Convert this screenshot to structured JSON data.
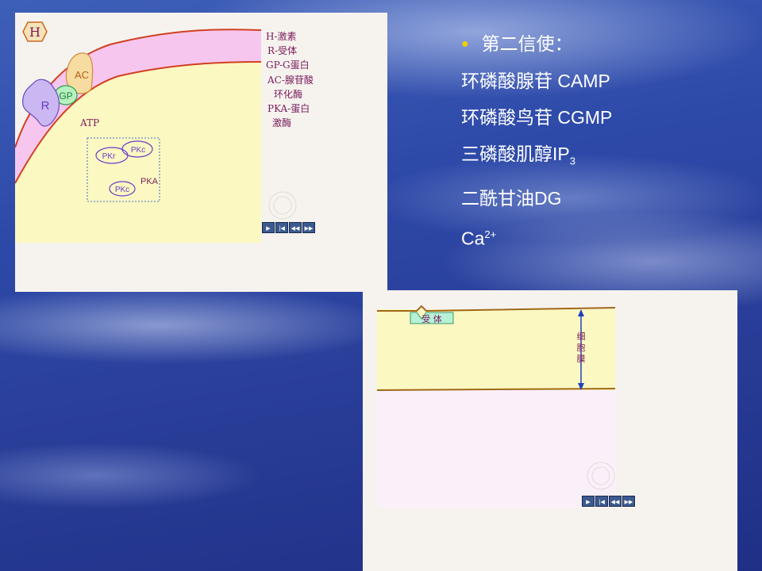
{
  "slide": {
    "bullet_title": "第二信使：",
    "messengers": [
      {
        "main": "环磷酸腺苷 CAMP",
        "sub": "",
        "sup": ""
      },
      {
        "main": "环磷酸鸟苷 CGMP",
        "sub": "",
        "sup": ""
      },
      {
        "main": "三磷酸肌醇IP",
        "sub": "3",
        "sup": ""
      },
      {
        "main": "二酰甘油DG",
        "sub": "",
        "sup": ""
      },
      {
        "main": "Ca",
        "sub": "",
        "sup": "2+"
      }
    ]
  },
  "diagram_a": {
    "labels": {
      "h": "H",
      "ac": "AC",
      "gp": "GP",
      "r": "R",
      "atp": "ATP",
      "pkr": "PKr",
      "pkc_top": "PKc",
      "pkc_bottom": "PKc",
      "pka": "PKA"
    },
    "legend": [
      "H-激素",
      "R-受体",
      "GP-G蛋白",
      "AC-腺苷酸",
      "环化酶",
      "PKA-蛋白",
      "激酶"
    ],
    "controls": [
      "▶",
      "|◀",
      "◀◀",
      "▶▶"
    ]
  },
  "diagram_b": {
    "receptor_label": "受  体",
    "membrane_label": [
      "细",
      "胞",
      "膜"
    ],
    "controls": [
      "▶",
      "|◀",
      "◀◀",
      "▶▶"
    ]
  },
  "colors": {
    "bullet": "#f0d000",
    "membrane_pink": "#f7c6ef",
    "cytoplasm_yellow": "#fcf8c2",
    "membrane_line": "#d04020",
    "handwriting": "#7a1a5a",
    "pk_ink": "#6a3cc8"
  }
}
